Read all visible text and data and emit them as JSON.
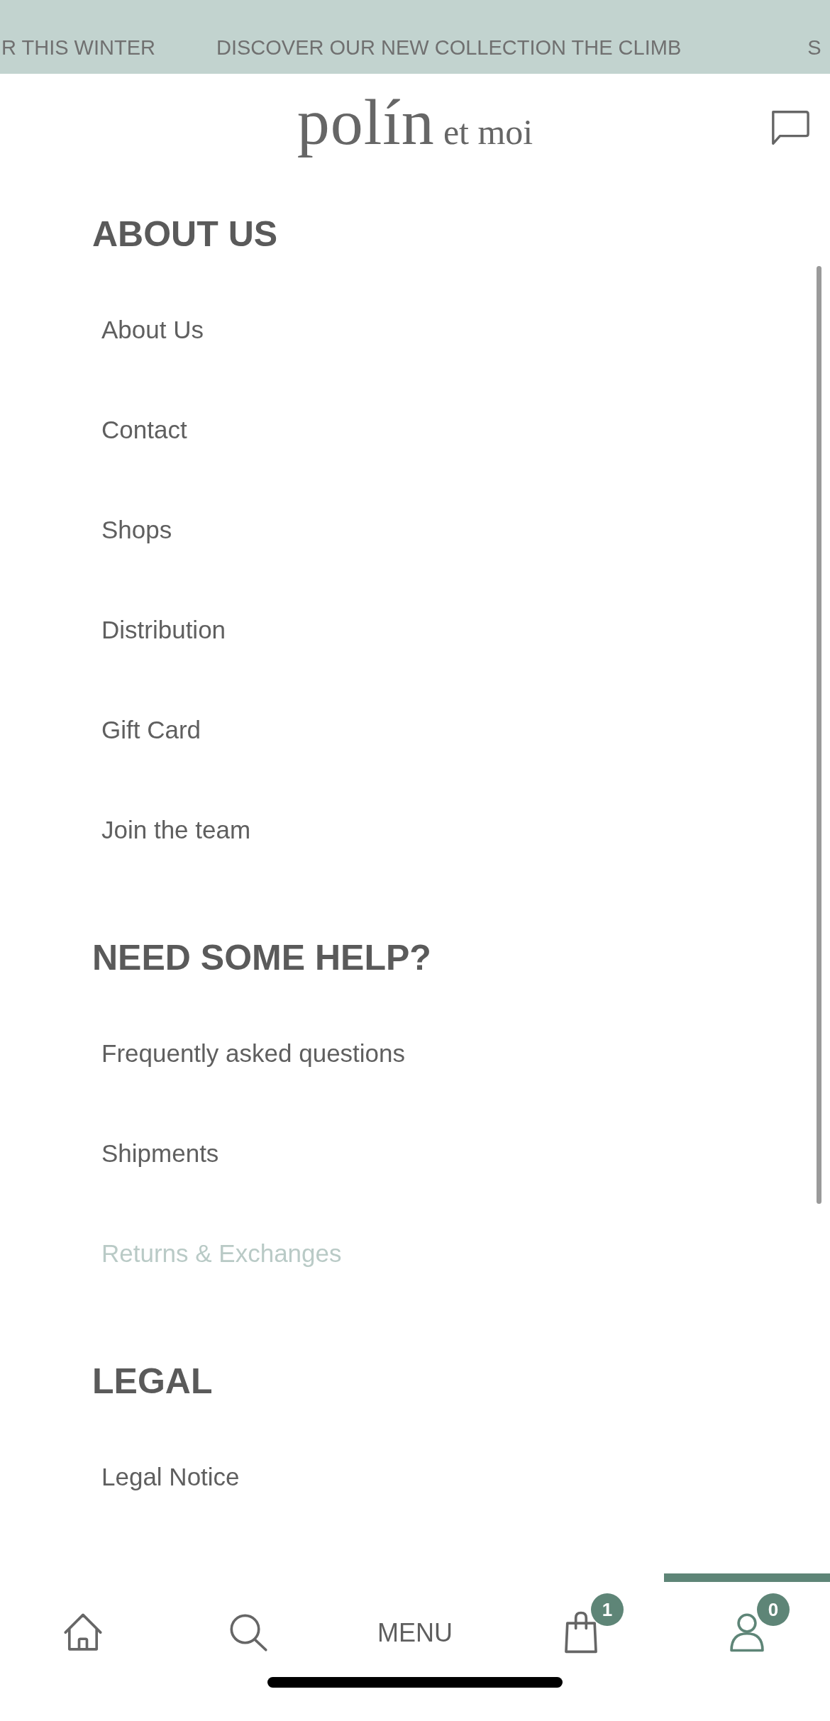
{
  "announcement_bar": {
    "messages": [
      "R THIS WINTER",
      "DISCOVER OUR NEW COLLECTION THE CLIMB",
      "S"
    ]
  },
  "header": {
    "logo": {
      "main": "polín",
      "sub": "et moi"
    }
  },
  "menu": {
    "sections": [
      {
        "title": "ABOUT US",
        "items": [
          {
            "label": "About Us",
            "selected": false
          },
          {
            "label": "Contact",
            "selected": false
          },
          {
            "label": "Shops",
            "selected": false
          },
          {
            "label": "Distribution",
            "selected": false
          },
          {
            "label": "Gift Card",
            "selected": false
          },
          {
            "label": "Join the team",
            "selected": false
          }
        ]
      },
      {
        "title": "NEED SOME HELP?",
        "items": [
          {
            "label": "Frequently asked questions",
            "selected": false
          },
          {
            "label": "Shipments",
            "selected": false
          },
          {
            "label": "Returns & Exchanges",
            "selected": true
          }
        ]
      },
      {
        "title": "LEGAL",
        "items": [
          {
            "label": "Legal Notice",
            "selected": false
          }
        ]
      }
    ]
  },
  "bottom_nav": [
    {
      "kind": "home",
      "selected": false
    },
    {
      "kind": "search",
      "selected": false
    },
    {
      "kind": "menu",
      "label": "MENU",
      "selected": false
    },
    {
      "kind": "bag",
      "badge": "1",
      "selected": false
    },
    {
      "kind": "account",
      "badge": "0",
      "selected": true
    }
  ]
}
